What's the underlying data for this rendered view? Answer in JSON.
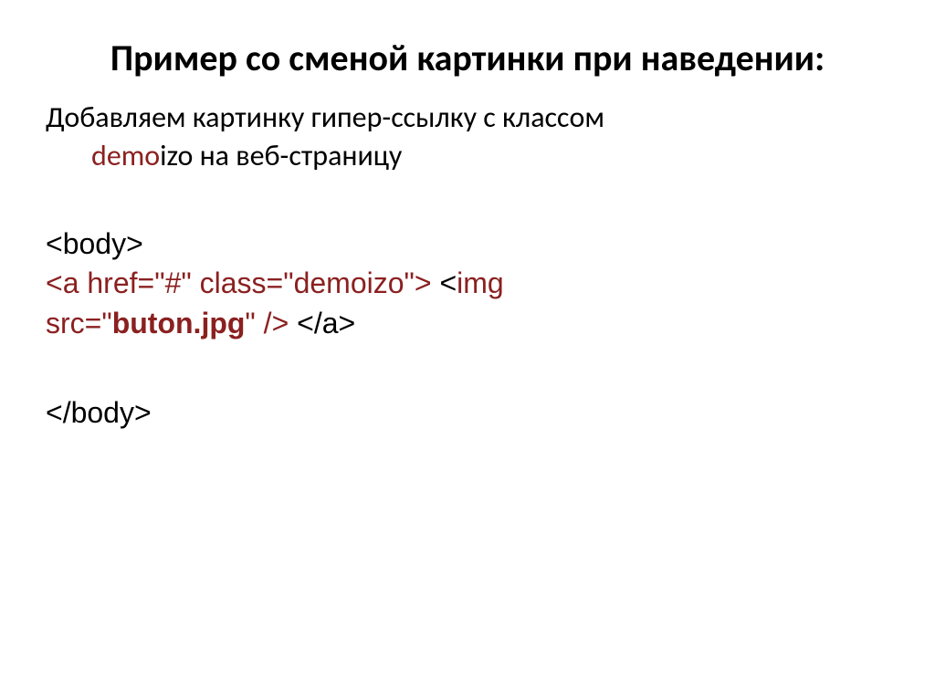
{
  "title": "Пример со сменой картинки при наведении:",
  "description": {
    "line1_part1": "Добавляем картинку гипер-ссылку с классом ",
    "line2_highlight": "demo",
    "line2_rest": "izo на веб-страницу"
  },
  "code": {
    "line1": "<body>",
    "line2_red": "<a href=\"#\" class=\"demoizo\">",
    "line2_black": " <",
    "line2_red2": "img ",
    "line3_red1": "src=\"",
    "line3_bold": "buton.jpg",
    "line3_red2": "\" />",
    "line3_black": " </a>",
    "line4": "</body>"
  }
}
